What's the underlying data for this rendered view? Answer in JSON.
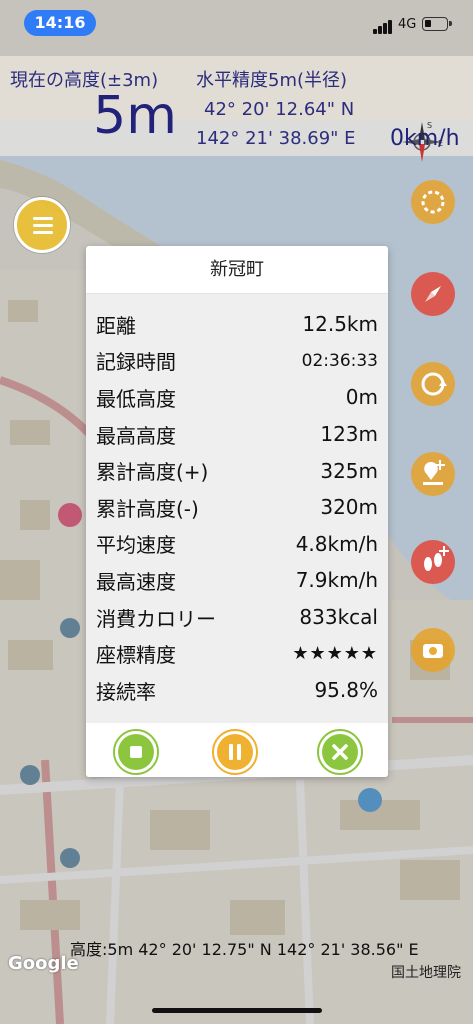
{
  "status_bar": {
    "time": "14:16",
    "network": "4G"
  },
  "header": {
    "altitude_label": "現在の高度(±3m)",
    "altitude_value": "5m",
    "accuracy_label": "水平精度5m(半径)",
    "latitude": "42° 20' 12.64\" N",
    "longitude": "142° 21' 38.69\" E",
    "speed": "0km/h"
  },
  "dialog": {
    "title": "新冠町",
    "stats": [
      {
        "label": "距離",
        "value": "12.5km"
      },
      {
        "label": "記録時間",
        "value": "02:36:33"
      },
      {
        "label": "最低高度",
        "value": "0m"
      },
      {
        "label": "最高高度",
        "value": "123m"
      },
      {
        "label": "累計高度(+)",
        "value": "325m"
      },
      {
        "label": "累計高度(-)",
        "value": "320m"
      },
      {
        "label": "平均速度",
        "value": "4.8km/h"
      },
      {
        "label": "最高速度",
        "value": "7.9km/h"
      },
      {
        "label": "消費カロリー",
        "value": "833kcal"
      },
      {
        "label": "座標精度",
        "value": "★★★★★"
      },
      {
        "label": "接続率",
        "value": "95.8%"
      }
    ],
    "actions": [
      {
        "icon": "stop-icon",
        "color": "#8cc63f"
      },
      {
        "icon": "pause-icon",
        "color": "#f0b030"
      },
      {
        "icon": "close-icon",
        "color": "#8cc63f"
      }
    ]
  },
  "bottom": {
    "coordinates": "高度:5m  42° 20' 12.75\" N 142° 21' 38.56\" E",
    "map_credit": "国土地理院",
    "google_logo": "Google"
  },
  "colors": {
    "header_text": "#2d2d7d",
    "time_pill": "#2f7cf6",
    "menu_button": "#eebe28",
    "tool_button": "#e9a020",
    "tool_button_red": "#e0473a"
  }
}
